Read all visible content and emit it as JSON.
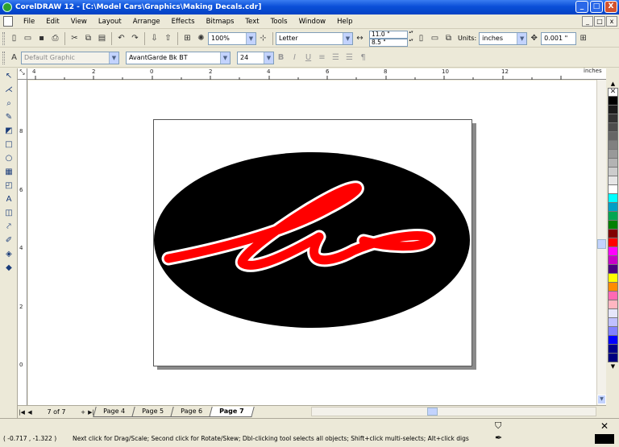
{
  "window": {
    "title": "CorelDRAW 12 - [C:\\Model Cars\\Graphics\\Making Decals.cdr]",
    "buttons": [
      "_",
      "□",
      "X"
    ]
  },
  "menu": {
    "items": [
      "File",
      "Edit",
      "View",
      "Layout",
      "Arrange",
      "Effects",
      "Bitmaps",
      "Text",
      "Tools",
      "Window",
      "Help"
    ],
    "doc_buttons": [
      "_",
      "□",
      "x"
    ]
  },
  "standard_toolbar": {
    "zoom": "100%",
    "paper": "Letter",
    "width": "11.0 \"",
    "height": "8.5 \"",
    "units_label": "Units:",
    "units": "inches",
    "nudge": "0.001 \""
  },
  "text_toolbar": {
    "style": "Default Graphic",
    "font": "AvantGarde Bk BT",
    "size": "24"
  },
  "rulers": {
    "unit": "inches",
    "h_ticks": [
      "4",
      "2",
      "0",
      "2",
      "4",
      "6",
      "8",
      "10",
      "12"
    ],
    "v_ticks": [
      "8",
      "6",
      "4",
      "2",
      "0"
    ]
  },
  "pages": {
    "count": "7 of 7",
    "tabs": [
      "Page 4",
      "Page 5",
      "Page 6",
      "Page 7"
    ],
    "active": "Page 7"
  },
  "palette": {
    "colors": [
      "#000000",
      "#1a1a1a",
      "#333333",
      "#4d4d4d",
      "#666666",
      "#808080",
      "#999999",
      "#b3b3b3",
      "#cccccc",
      "#e6e6e6",
      "#ffffff",
      "#00ffff",
      "#00a0c6",
      "#00a651",
      "#008000",
      "#800000",
      "#ff0000",
      "#ff00ff",
      "#c800c8",
      "#4b0082",
      "#ffff00",
      "#ff8c00",
      "#ff69b4",
      "#ffb6c1",
      "#e6e6fa",
      "#c0c0ff",
      "#8080ff",
      "#0000ff",
      "#00008b",
      "#000080"
    ]
  },
  "status": {
    "coords": "( -0.717 , -1.322 )",
    "hint": "Next click for Drag/Scale; Second click for Rotate/Skew; Dbl-clicking tool selects all objects; Shift+click multi-selects; Alt+click digs"
  },
  "drawing": {
    "ellipse_fill": "#000000",
    "script_fill": "#ff0000",
    "script_outline": "#ffffff"
  }
}
